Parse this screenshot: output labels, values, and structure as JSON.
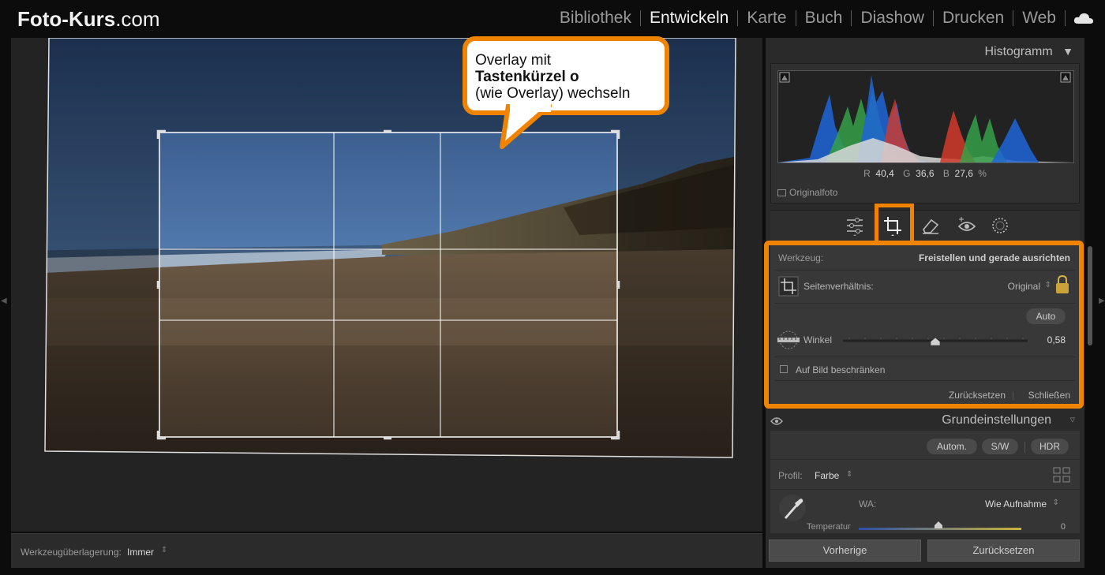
{
  "brand": {
    "bold": "Foto-Kurs",
    "rest": ".com"
  },
  "modules": [
    "Bibliothek",
    "Entwickeln",
    "Karte",
    "Buch",
    "Diashow",
    "Drucken",
    "Web"
  ],
  "active_module": "Entwickeln",
  "callout": {
    "line1": "Overlay mit",
    "line2": "Tastenkürzel o",
    "line3": "(wie Overlay) wechseln"
  },
  "toolbar": {
    "overlay_label": "Werkzeugüberlagerung:",
    "overlay_value": "Immer"
  },
  "histogram": {
    "title": "Histogramm",
    "r_label": "R",
    "r_value": "40,4",
    "g_label": "G",
    "g_value": "36,6",
    "b_label": "B",
    "b_value": "27,6",
    "percent": "%",
    "original_label": "Originalfoto"
  },
  "tools": [
    "sliders-icon",
    "crop-icon",
    "eraser-icon",
    "redeye-icon",
    "mask-icon"
  ],
  "crop": {
    "tool_label": "Werkzeug:",
    "tool_value": "Freistellen und gerade ausrichten",
    "aspect_label": "Seitenverhältnis:",
    "aspect_value": "Original",
    "auto_label": "Auto",
    "angle_label": "Winkel",
    "angle_value": "0,58",
    "constrain_label": "Auf Bild beschränken",
    "reset_label": "Zurücksetzen",
    "close_label": "Schließen"
  },
  "basic": {
    "title": "Grundeinstellungen",
    "auto_btn": "Autom.",
    "bw_btn": "S/W",
    "hdr_btn": "HDR",
    "profile_label": "Profil:",
    "profile_value": "Farbe",
    "wb_label": "WA:",
    "wb_value": "Wie Aufnahme",
    "temp_label": "Temperatur",
    "temp_value": "0"
  },
  "nav": {
    "prev": "Vorherige",
    "reset": "Zurücksetzen"
  },
  "colors": {
    "accent": "#f08400"
  }
}
